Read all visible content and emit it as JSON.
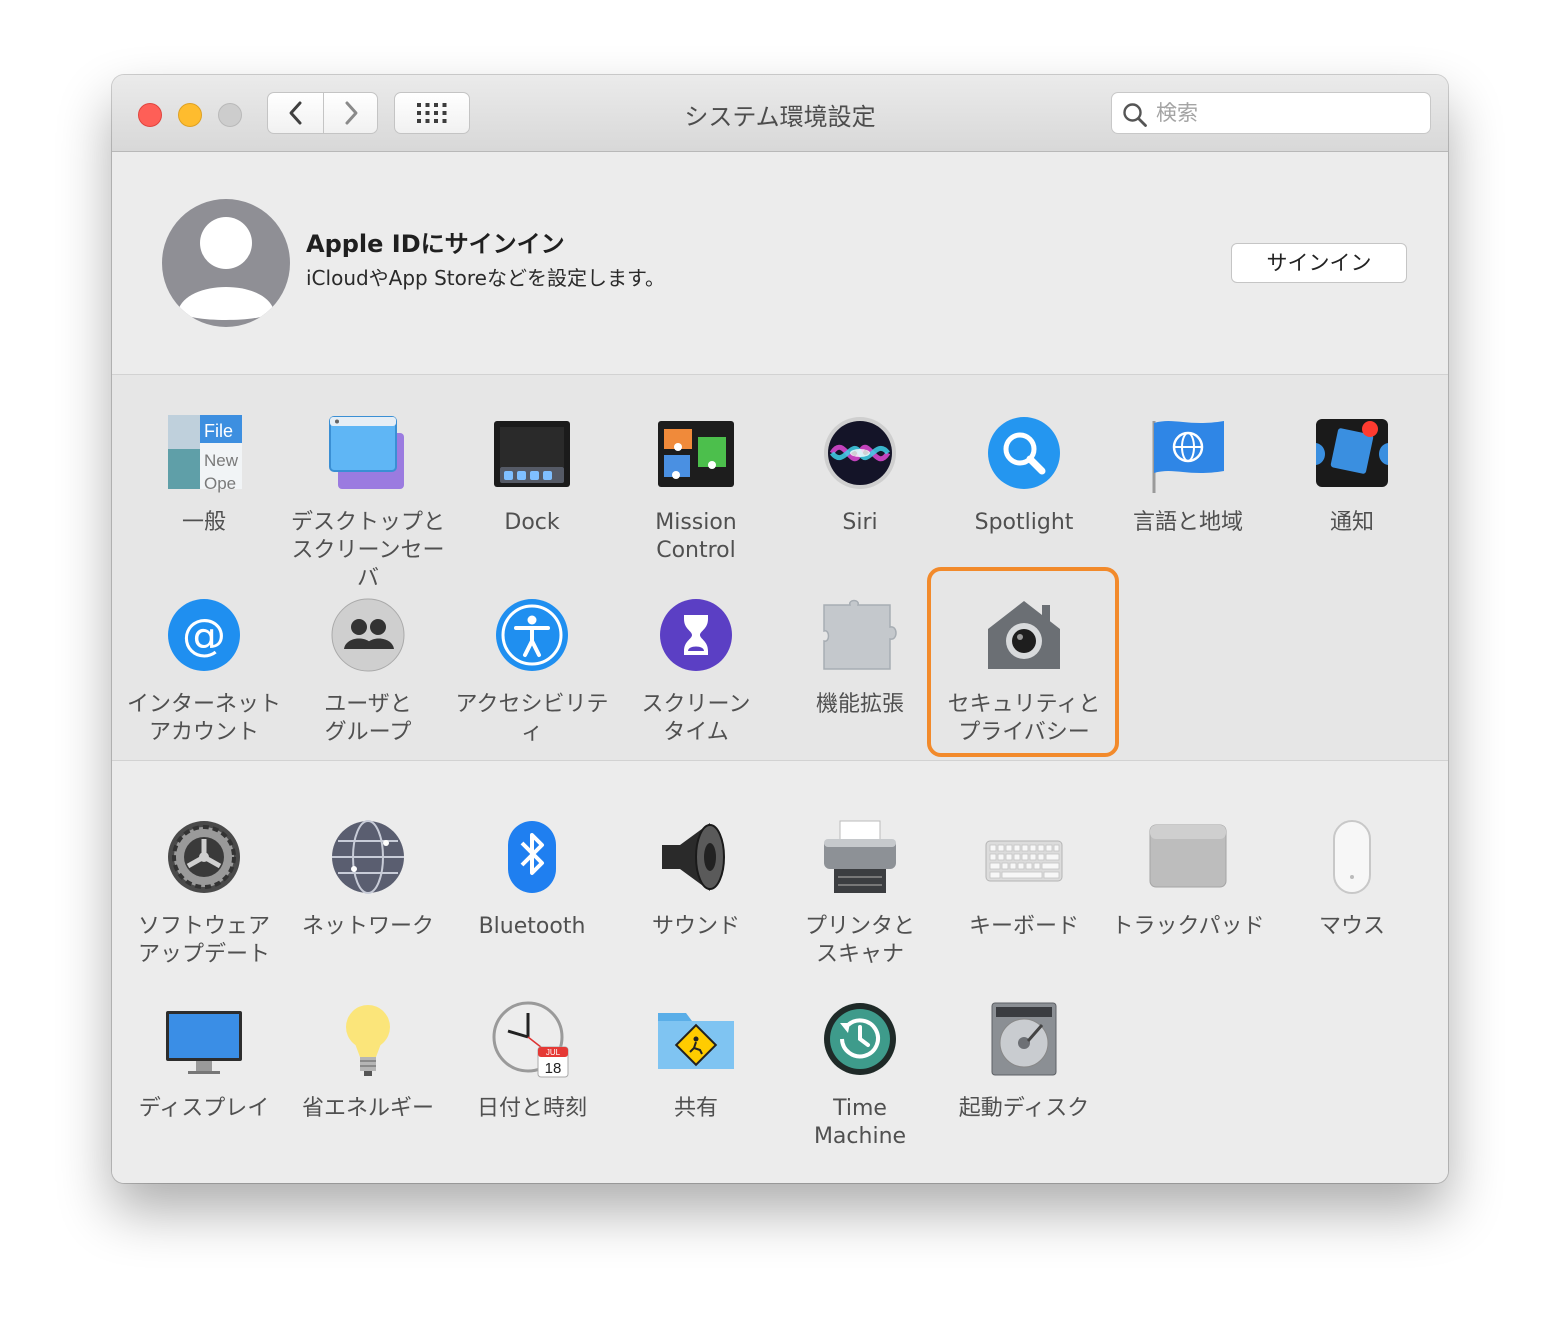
{
  "window": {
    "title": "システム環境設定",
    "search_placeholder": "検索",
    "search_value": ""
  },
  "apple_id": {
    "title": "Apple IDにサインイン",
    "subtitle": "iCloudやApp Storeなどを設定します。",
    "signin_label": "サインイン"
  },
  "personal_prefs": [
    {
      "label": "一般",
      "icon": "general-icon"
    },
    {
      "label": "デスクトップと\nスクリーンセーバ",
      "icon": "desktop-screensaver-icon"
    },
    {
      "label": "Dock",
      "icon": "dock-icon"
    },
    {
      "label": "Mission\nControl",
      "icon": "mission-control-icon"
    },
    {
      "label": "Siri",
      "icon": "siri-icon"
    },
    {
      "label": "Spotlight",
      "icon": "spotlight-icon"
    },
    {
      "label": "言語と地域",
      "icon": "language-region-icon"
    },
    {
      "label": "通知",
      "icon": "notifications-icon"
    },
    {
      "label": "インターネット\nアカウント",
      "icon": "internet-accounts-icon"
    },
    {
      "label": "ユーザと\nグループ",
      "icon": "users-groups-icon"
    },
    {
      "label": "アクセシビリティ",
      "icon": "accessibility-icon"
    },
    {
      "label": "スクリーン\nタイム",
      "icon": "screen-time-icon"
    },
    {
      "label": "機能拡張",
      "icon": "extensions-icon"
    },
    {
      "label": "セキュリティと\nプライバシー",
      "icon": "security-privacy-icon"
    }
  ],
  "hardware_prefs": [
    {
      "label": "ソフトウェア\nアップデート",
      "icon": "software-update-icon"
    },
    {
      "label": "ネットワーク",
      "icon": "network-icon"
    },
    {
      "label": "Bluetooth",
      "icon": "bluetooth-icon"
    },
    {
      "label": "サウンド",
      "icon": "sound-icon"
    },
    {
      "label": "プリンタと\nスキャナ",
      "icon": "printers-scanners-icon"
    },
    {
      "label": "キーボード",
      "icon": "keyboard-icon"
    },
    {
      "label": "トラックパッド",
      "icon": "trackpad-icon"
    },
    {
      "label": "マウス",
      "icon": "mouse-icon"
    },
    {
      "label": "ディスプレイ",
      "icon": "displays-icon"
    },
    {
      "label": "省エネルギー",
      "icon": "energy-saver-icon"
    },
    {
      "label": "日付と時刻",
      "icon": "date-time-icon"
    },
    {
      "label": "共有",
      "icon": "sharing-icon"
    },
    {
      "label": "Time\nMachine",
      "icon": "time-machine-icon"
    },
    {
      "label": "起動ディスク",
      "icon": "startup-disk-icon"
    }
  ],
  "general_icon_text": {
    "file": "File",
    "new": "New",
    "open": "Ope"
  },
  "calendar_icon_text": {
    "month": "JUL",
    "day": "18"
  },
  "highlighted_pane": "security-privacy-icon",
  "colors": {
    "highlight": "#f28a2b",
    "close": "#fe5f57",
    "minimize": "#febc2e",
    "zoom": "#cdcdcd"
  }
}
